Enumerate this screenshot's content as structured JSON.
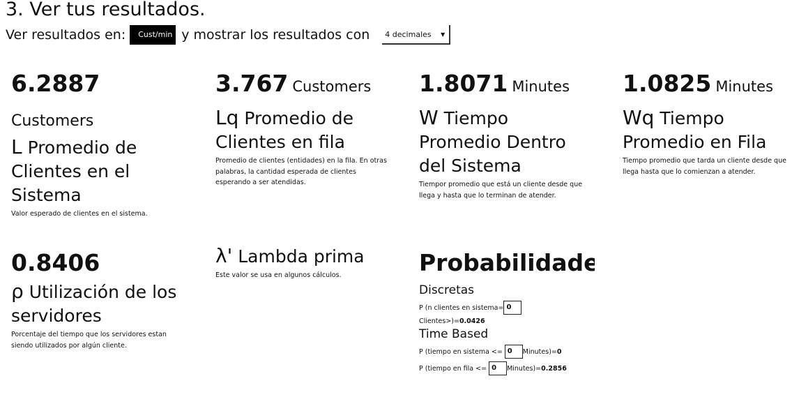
{
  "header": {
    "title": "3. Ver tus resultados.",
    "view_in_label": "Ver resultados en:",
    "unit_value": "Cust/min",
    "show_with_label": "y mostrar los resultados con",
    "decimals_value": "4 decimales"
  },
  "metrics": {
    "L": {
      "value": "6.2887",
      "unit": "Customers",
      "symbol": "L",
      "label": "Promedio de Clientes en el Sistema",
      "desc": "Valor esperado de clientes en el sistema."
    },
    "Lq": {
      "value": "3.767",
      "unit": "Customers",
      "symbol": "Lq",
      "label": "Promedio de Clientes en fila",
      "desc": "Promedio de clientes (entidades) en la fila. En otras palabras, la cantidad esperada de clientes esperando a ser atendidas."
    },
    "W": {
      "value": "1.8071",
      "unit": "Minutes",
      "symbol": "W",
      "label": "Tiempo Promedio Dentro del Sistema",
      "desc": "Tiempor promedio que está un cliente desde que llega y hasta que lo terminan de atender."
    },
    "Wq": {
      "value": "1.0825",
      "unit": "Minutes",
      "symbol": "Wq",
      "label": "Tiempo Promedio en Fila",
      "desc": "Tiempo promedio que tarda un cliente desde que llega hasta que lo comienzan a atender."
    },
    "rho": {
      "value": "0.8406",
      "symbol": "ρ",
      "label": "Utilización de los servidores",
      "desc": "Porcentaje del tiempo que los servidores estan siendo utilizados por algún cliente."
    },
    "lambda": {
      "symbol": "λ'",
      "label": "Lambda prima",
      "desc": "Este valor se usa en algunos cálculos."
    }
  },
  "probabilities": {
    "title": "Probabilidades",
    "discrete_title": "Discretas",
    "discrete_label": "P (n clientes en sistema=",
    "discrete_input": "0",
    "discrete_result_prefix": "Clientes>)=",
    "discrete_result": "0.0426",
    "time_title": "Time Based",
    "sys_label": "P (tiempo en sistema <=",
    "sys_input": "0",
    "sys_unit": "Minutes)=",
    "sys_result": "0",
    "queue_label": "P (tiempo en fila <=",
    "queue_input": "0",
    "queue_unit": "Minutes)=",
    "queue_result": "0.2856"
  }
}
